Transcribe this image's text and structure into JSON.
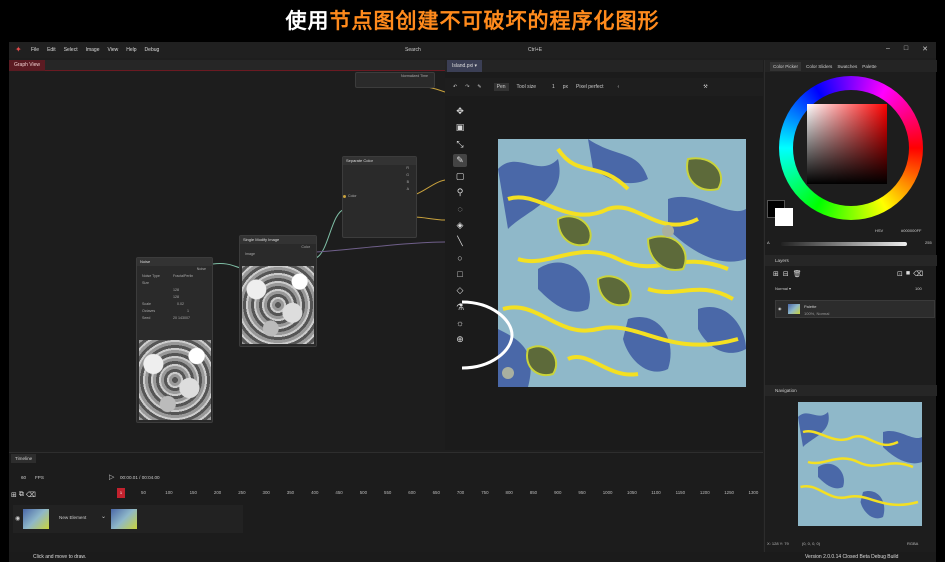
{
  "banner": {
    "prefix": "使用",
    "highlight": "节点图创建不可破坏的程序化图形"
  },
  "menubar": {
    "items": [
      "File",
      "Edit",
      "Select",
      "Image",
      "View",
      "Help",
      "Debug"
    ],
    "search": "Search",
    "search_shortcut": "Ctrl+E"
  },
  "graph": {
    "tab": "Graph View",
    "top_node": {
      "rows": [
        "Normalized Time"
      ]
    },
    "separate_color": {
      "title": "Separate Color",
      "input": "Color",
      "outputs": [
        "R",
        "G",
        "B",
        "A"
      ]
    },
    "modify": {
      "title": "Single Modify Image",
      "out_label": "Color",
      "in_label": "Image"
    },
    "noise": {
      "title": "Noise",
      "noise_label": "Noise",
      "rows": [
        {
          "label": "Noise Type",
          "value": "FractalPerlin"
        },
        {
          "label": "Size",
          "value": ""
        },
        {
          "label": "",
          "value": "128"
        },
        {
          "label": "",
          "value": "128"
        },
        {
          "label": "Scale",
          "value": "0.02"
        },
        {
          "label": "Octaves",
          "value": "1"
        },
        {
          "label": "Seed",
          "value": "20 143007"
        }
      ]
    }
  },
  "canvas": {
    "tab": "Island.pxi",
    "toolbar": {
      "tool": "Pen",
      "tool_size_label": "Tool size",
      "tool_size": "1",
      "unit": "px",
      "pixel_perfect": "Pixel perfect"
    },
    "tools": [
      "move-icon",
      "select-icon",
      "lasso-icon",
      "pen-icon",
      "rectangle-select-icon",
      "magic-wand-icon",
      "ellipse-select-icon",
      "fill-icon",
      "line-icon",
      "ellipse-icon",
      "rectangle-icon",
      "eraser-icon",
      "color-picker-icon",
      "brightness-icon",
      "zoom-icon"
    ],
    "palette": {
      "deep": "#4a68a8",
      "shallow": "#8fb8c9",
      "sand": "#c9d33a",
      "grass": "#5d6a3a",
      "yellow": "#f4e022"
    }
  },
  "right": {
    "tabs": [
      "Color Picker",
      "Color Sliders",
      "Swatches",
      "Palette"
    ],
    "hsv_mode": "HSV",
    "hex": "#000000FF",
    "alpha_label": "A",
    "alpha_value": "255",
    "layers_title": "Layers",
    "blend_mode": "Normal",
    "opacity": "100",
    "layer": {
      "name": "Palette",
      "detail": "100%, Normal"
    },
    "navigation_title": "Navigation",
    "coords": "X: 128 Y: 79",
    "pixel_value": "(0, 0, 0, 0)",
    "format": "RGBA",
    "version": "Version 2.0.0.14 Closed Beta Debug Build"
  },
  "timeline": {
    "tab": "Timeline",
    "fps": "60",
    "fps_label": "FPS",
    "time": "00:00.01 / 00:04.00",
    "playhead": "1",
    "ticks": [
      "50",
      "100",
      "150",
      "200",
      "250",
      "300",
      "350",
      "400",
      "450",
      "500",
      "550",
      "600",
      "650",
      "700",
      "750",
      "800",
      "850",
      "900",
      "950",
      "1000",
      "1050",
      "1100",
      "1150",
      "1200",
      "1250",
      "1300"
    ],
    "element": "New Element"
  },
  "status": {
    "hint": "Click and move to draw."
  }
}
